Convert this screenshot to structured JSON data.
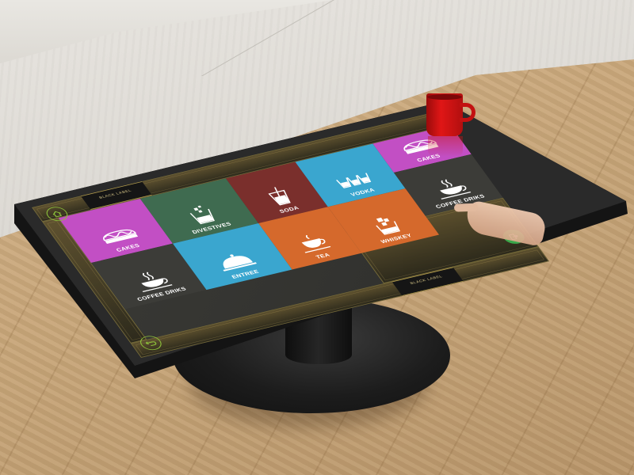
{
  "home_button": {
    "icon": "home-icon",
    "color": "#8bbf3a"
  },
  "back_button": {
    "icon": "back-arrow-icon",
    "color": "#8bbf3a"
  },
  "exit_button": {
    "icon": "exit-icon",
    "color": "#3aa84a"
  },
  "top_plate": {
    "line1": "BLACK LABEL"
  },
  "bottom_plate": {
    "line1": "BLACK LABEL"
  },
  "tiles": [
    {
      "label": "CAKES",
      "icon": "cake-icon",
      "color": "#c24fc4"
    },
    {
      "label": "DIVESTIVES",
      "icon": "glass-ice-icon",
      "color": "#3f6b50"
    },
    {
      "label": "SODA",
      "icon": "soda-glass-icon",
      "color": "#7a2f2c"
    },
    {
      "label": "VODKA",
      "icon": "shot-glasses-icon",
      "color": "#3aa6cf"
    },
    {
      "label": "CAKES",
      "icon": "cake-icon",
      "color": "#c24fc4"
    },
    {
      "label": "COFFEE DRIKS",
      "icon": "coffee-cup-icon",
      "color": "#3c3c38"
    },
    {
      "label": "ENTREE",
      "icon": "cloche-icon",
      "color": "#3aa6cf"
    },
    {
      "label": "TEA",
      "icon": "teacup-icon",
      "color": "#d5692c"
    },
    {
      "label": "WHISKEY",
      "icon": "whiskey-glass-icon",
      "color": "#d5692c"
    },
    {
      "label": "COFFEE DRIKS",
      "icon": "coffee-cup-icon",
      "color": "#3c3c38"
    }
  ]
}
